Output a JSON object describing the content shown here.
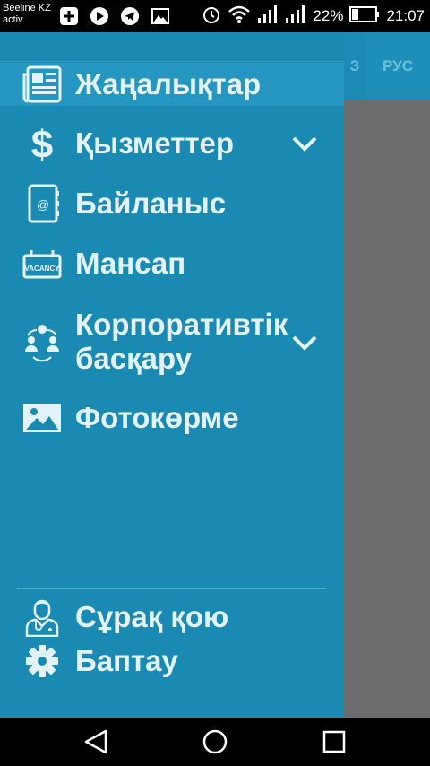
{
  "status_bar": {
    "carrier_line1": "Beeline KZ",
    "carrier_line2": "activ",
    "battery_percent": "22%",
    "time": "21:07"
  },
  "header": {
    "lang_kz": "З",
    "lang_ru": "РУС"
  },
  "drawer": {
    "items": [
      {
        "label": "Жаңалықтар",
        "icon": "newspaper-icon"
      },
      {
        "label": "Қызметтер",
        "icon": "dollar-icon"
      },
      {
        "label": "Байланыс",
        "icon": "contact-book-icon"
      },
      {
        "label": "Мансап",
        "icon": "vacancy-icon",
        "icon_text": "VACANCY"
      },
      {
        "label_line1": "Корпоративтік",
        "label_line2": "басқару",
        "icon": "people-group-icon"
      },
      {
        "label": "Фотокөрме",
        "icon": "image-icon"
      }
    ],
    "footer_items": [
      {
        "label": "Сұрақ қою",
        "icon": "doctor-icon"
      },
      {
        "label": "Баптау",
        "icon": "gear-icon"
      }
    ]
  },
  "colors": {
    "drawer_bg": "#1a8ab3",
    "active_bg": "#2596bf",
    "text": "#e3f3fa"
  }
}
